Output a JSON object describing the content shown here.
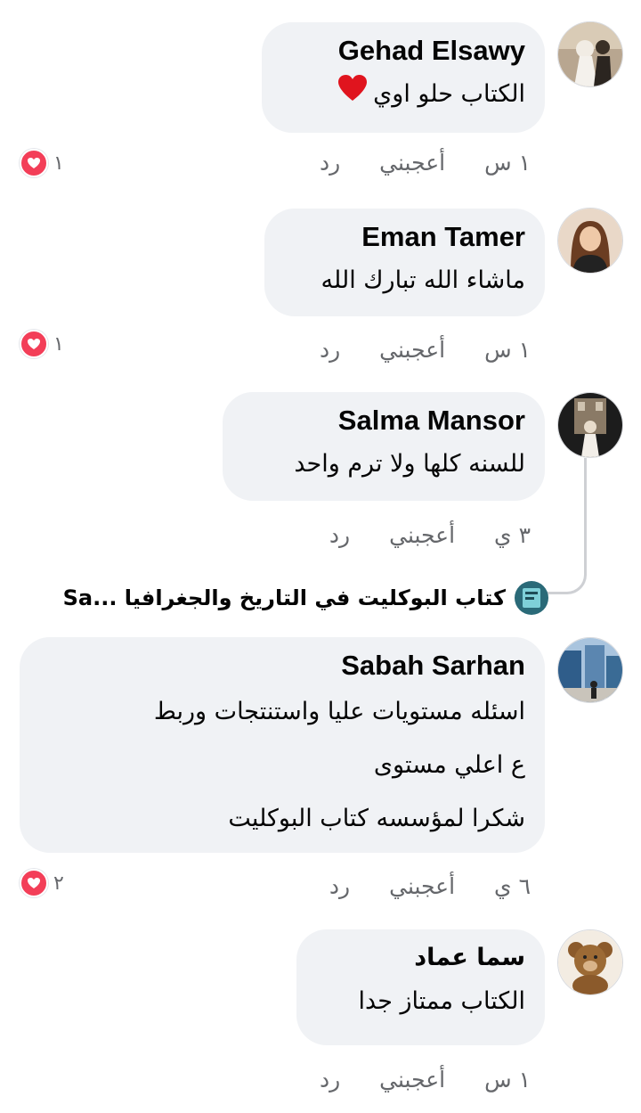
{
  "comments": [
    {
      "name": "Gehad Elsawy",
      "lines": [
        "الكتاب حلو اوي"
      ],
      "emoji": "heart",
      "time": "١ س",
      "like": "أعجبني",
      "reply": "رد",
      "reaction_count": "١"
    },
    {
      "name": "Eman Tamer",
      "lines": [
        "ماشاء الله تبارك الله"
      ],
      "time": "١ س",
      "like": "أعجبني",
      "reply": "رد",
      "reaction_count": "١"
    },
    {
      "name": "Salma Mansor",
      "lines": [
        "للسنه كلها ولا ترم واحد"
      ],
      "time": "٣ ي",
      "like": "أعجبني",
      "reply": "رد"
    },
    {
      "name": "Sabah Sarhan",
      "lines": [
        "اسئله مستويات عليا واستنتجات وربط",
        "ع اعلي مستوى",
        "شكرا لمؤسسه كتاب البوكليت"
      ],
      "time": "٦ ي",
      "like": "أعجبني",
      "reply": "رد",
      "reaction_count": "٢"
    },
    {
      "name": "سما عماد",
      "lines": [
        "الكتاب ممتاز جدا"
      ],
      "time": "١ س",
      "like": "أعجبني",
      "reply": "رد"
    }
  ],
  "reply_preview": "كتاب البوكليت في التاريخ والجغرافيا ...Sa",
  "colors": {
    "bubble": "#f0f2f5",
    "meta": "#65676b",
    "love": "#f33e58",
    "heart_emoji": "#e0141e",
    "thread": "#ced0d4"
  }
}
